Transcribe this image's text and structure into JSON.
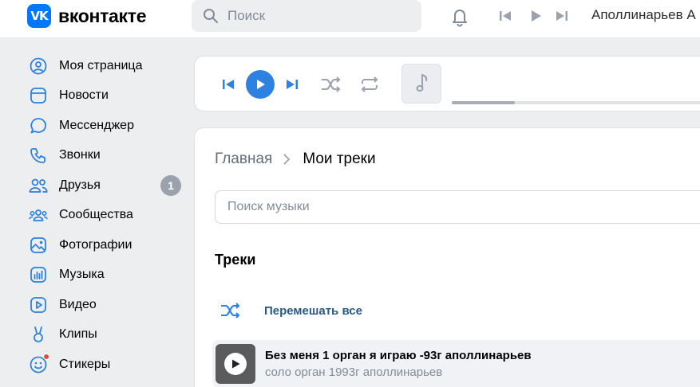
{
  "header": {
    "logo_badge": "VK",
    "logo_text": "вконтакте",
    "search_placeholder": "Поиск",
    "user_name": "Аполлинарьев А"
  },
  "sidebar": {
    "items": [
      {
        "label": "Моя страница",
        "icon": "user-circle-icon"
      },
      {
        "label": "Новости",
        "icon": "news-icon"
      },
      {
        "label": "Мессенджер",
        "icon": "message-icon"
      },
      {
        "label": "Звонки",
        "icon": "phone-icon"
      },
      {
        "label": "Друзья",
        "icon": "friends-icon",
        "badge": "1"
      },
      {
        "label": "Сообщества",
        "icon": "communities-icon"
      },
      {
        "label": "Фотографии",
        "icon": "photo-icon"
      },
      {
        "label": "Музыка",
        "icon": "music-icon"
      },
      {
        "label": "Видео",
        "icon": "video-icon"
      },
      {
        "label": "Клипы",
        "icon": "clips-icon"
      },
      {
        "label": "Стикеры",
        "icon": "stickers-icon"
      }
    ]
  },
  "player": {
    "progress": 0.24
  },
  "main": {
    "breadcrumb_home": "Главная",
    "breadcrumb_current": "Мои треки",
    "search_placeholder": "Поиск музыки",
    "section_title": "Треки",
    "shuffle_label": "Перемешать все",
    "tracks": [
      {
        "title": "Без меня 1 орган я играю -93г аполлинарьев",
        "artist": "соло орган 1993г аполлинарьев"
      }
    ]
  },
  "colors": {
    "accent": "#2d81e0",
    "brand": "#0077ff",
    "link": "#2a5885",
    "badge": "#99a2ad",
    "notify": "#e64646"
  }
}
